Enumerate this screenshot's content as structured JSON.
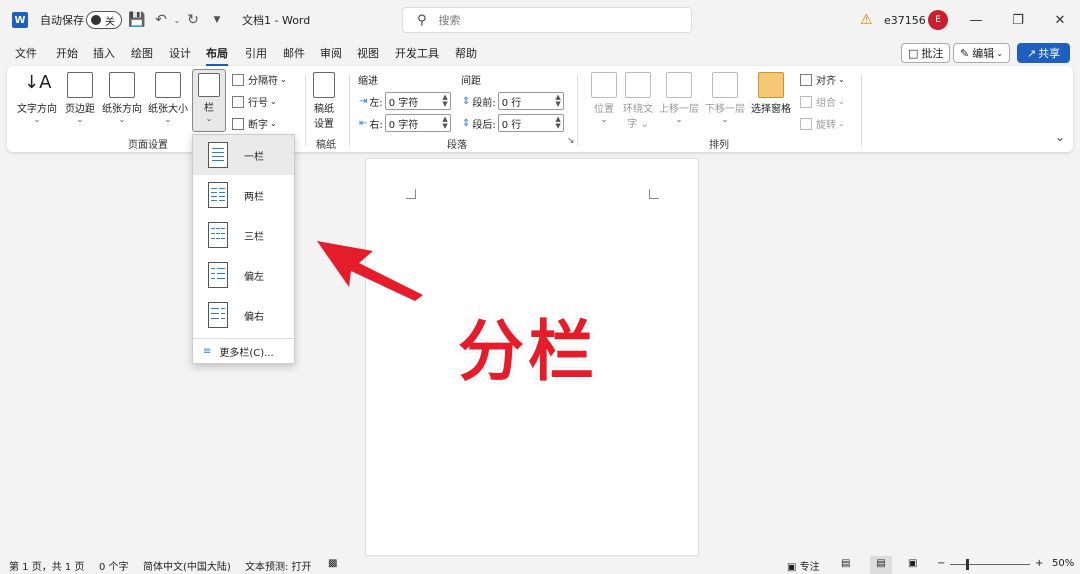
{
  "titlebar": {
    "autosave_label": "自动保存",
    "toggle_state": "关",
    "doc_title": "文档1 - Word",
    "search_placeholder": "搜索",
    "user_name": "e37156",
    "avatar_initial": "E"
  },
  "tabs": [
    "文件",
    "开始",
    "插入",
    "绘图",
    "设计",
    "布局",
    "引用",
    "邮件",
    "审阅",
    "视图",
    "开发工具",
    "帮助"
  ],
  "active_tab": "布局",
  "right_buttons": {
    "comment": "批注",
    "edit": "编辑",
    "share": "共享"
  },
  "ribbon": {
    "page_setup": {
      "text_direction": "文字方向",
      "margins": "页边距",
      "orientation": "纸张方向",
      "size": "纸张大小",
      "columns": "栏",
      "breaks": "分隔符",
      "line_numbers": "行号",
      "hyphenation": "断字",
      "group_label": "页面设置"
    },
    "manuscript": {
      "label": "稿纸\n设置",
      "label1": "稿纸",
      "label2": "设置",
      "group_label": "稿纸"
    },
    "paragraph": {
      "indent_title": "缩进",
      "spacing_title": "间距",
      "left_label": "左:",
      "left_value": "0 字符",
      "right_label": "右:",
      "right_value": "0 字符",
      "before_label": "段前:",
      "before_value": "0 行",
      "after_label": "段后:",
      "after_value": "0 行",
      "group_label": "段落"
    },
    "arrange": {
      "position": "位置",
      "wrap_text_1": "环绕文",
      "wrap_text_2": "字",
      "bring_forward": "上移一层",
      "send_backward": "下移一层",
      "selection_pane": "选择窗格",
      "align": "对齐",
      "group": "组合",
      "rotate": "旋转",
      "group_label": "排列"
    }
  },
  "columns_menu": {
    "items": [
      "一栏",
      "两栏",
      "三栏",
      "偏左",
      "偏右"
    ],
    "more": "更多栏(C)..."
  },
  "overlay_text": "分栏",
  "statusbar": {
    "page": "第 1 页，共 1 页",
    "words": "0 个字",
    "language": "简体中文(中国大陆)",
    "prediction": "文本预测: 打开",
    "focus": "专注",
    "zoom": "50%"
  },
  "colors": {
    "accent": "#1e5fbf",
    "overlay_red": "#e51d2a",
    "arrow_red": "#e51d2a"
  }
}
